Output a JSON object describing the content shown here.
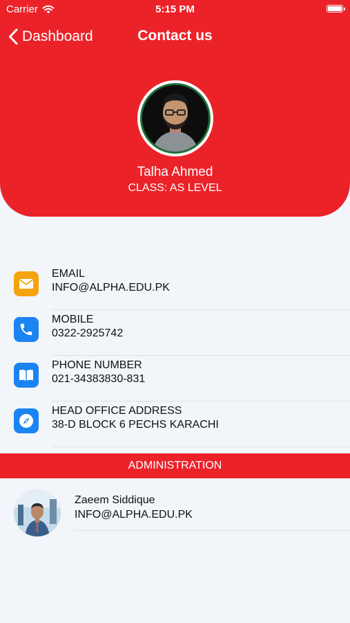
{
  "status_bar": {
    "carrier": "Carrier",
    "time": "5:15 PM",
    "battery_level": 1.0
  },
  "nav": {
    "back_label": "Dashboard",
    "title": "Contact us"
  },
  "profile": {
    "name": "Talha Ahmed",
    "class_text": "CLASS: AS LEVEL"
  },
  "contacts": [
    {
      "label": "EMAIL",
      "value": "INFO@ALPHA.EDU.PK",
      "icon": "mail-icon",
      "color": "#f4a30d"
    },
    {
      "label": "MOBILE",
      "value": "0322-2925742",
      "icon": "phone-icon",
      "color": "#1a84f2"
    },
    {
      "label": "PHONE NUMBER",
      "value": "021-34383830-831",
      "icon": "book-icon",
      "color": "#1a84f2"
    },
    {
      "label": "HEAD OFFICE ADDRESS",
      "value": "38-D BLOCK 6 PECHS KARACHI",
      "icon": "compass-icon",
      "color": "#1a84f2"
    }
  ],
  "admin": {
    "section_title": "ADMINISTRATION",
    "name": "Zaeem Siddique",
    "email": "INFO@ALPHA.EDU.PK"
  },
  "colors": {
    "primary_red": "#ec2229",
    "background": "#f2f5f9",
    "avatar_ring": "#1f6f3a"
  }
}
